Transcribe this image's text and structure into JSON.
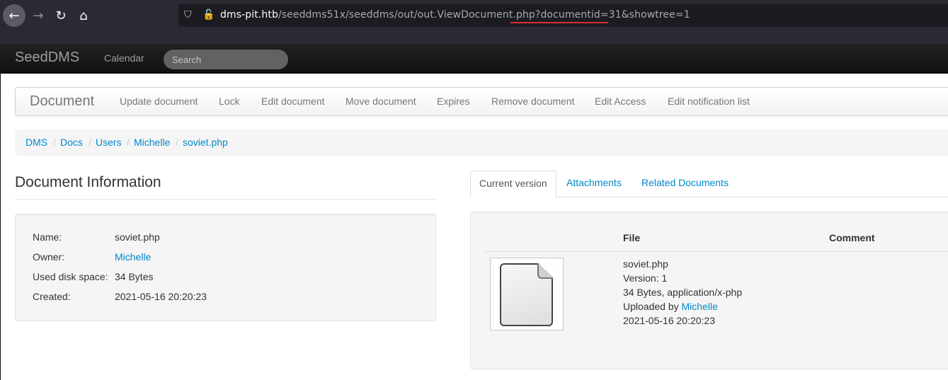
{
  "browser": {
    "url_host": "dms-pit.htb",
    "url_path": "/seeddms51x/seeddms/out/out.ViewDocument.php?documentid=31&showtree=1"
  },
  "navbar": {
    "brand": "SeedDMS",
    "calendar": "Calendar",
    "search_placeholder": "Search"
  },
  "toolbar": {
    "title": "Document",
    "items": [
      "Update document",
      "Lock",
      "Edit document",
      "Move document",
      "Expires",
      "Remove document",
      "Edit Access",
      "Edit notification list"
    ]
  },
  "breadcrumb": [
    "DMS",
    "Docs",
    "Users",
    "Michelle",
    "soviet.php"
  ],
  "doc_info": {
    "title": "Document Information",
    "rows": [
      {
        "label": "Name:",
        "value": "soviet.php"
      },
      {
        "label": "Owner:",
        "value": "Michelle"
      },
      {
        "label": "Used disk space:",
        "value": "34 Bytes"
      },
      {
        "label": "Created:",
        "value": "2021-05-16 20:20:23"
      }
    ]
  },
  "tabs": [
    "Current version",
    "Attachments",
    "Related Documents"
  ],
  "version": {
    "col_file": "File",
    "col_comment": "Comment",
    "file_name": "soviet.php",
    "version": "Version: 1",
    "size_type": "34 Bytes, application/x-php",
    "uploaded_by_prefix": "Uploaded by",
    "uploaded_by_user": "Michelle",
    "date": "2021-05-16 20:20:23"
  }
}
